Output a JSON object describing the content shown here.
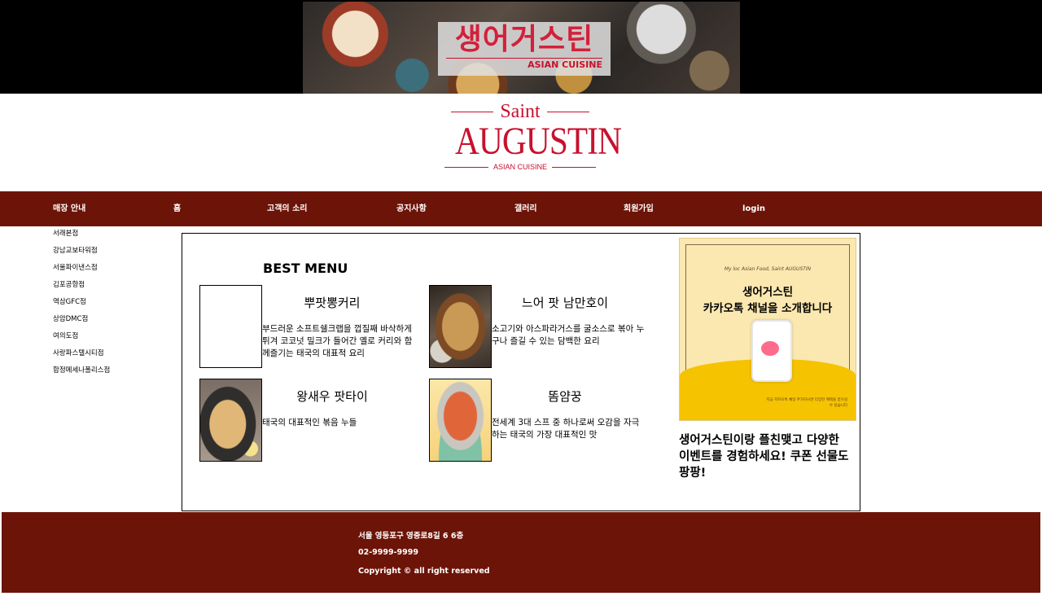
{
  "banner": {
    "sign_korean": "생어거스틴",
    "sign_english": "ASIAN CUISINE"
  },
  "logo": {
    "saint": "Saint",
    "main": "AUGUSTIN",
    "sub": "ASIAN CUISINE"
  },
  "nav": {
    "items": [
      {
        "label": "매장 안내"
      },
      {
        "label": "홈"
      },
      {
        "label": "고객의 소리"
      },
      {
        "label": "공지사항"
      },
      {
        "label": "갤러리"
      },
      {
        "label": "회원가입"
      },
      {
        "label": "login"
      }
    ]
  },
  "sidebar": {
    "items": [
      {
        "label": "서래본점"
      },
      {
        "label": "강남교보타워점"
      },
      {
        "label": "서울파이낸스점"
      },
      {
        "label": "김포공항점"
      },
      {
        "label": "역삼GFC점"
      },
      {
        "label": "상암DMC점"
      },
      {
        "label": "여의도점"
      },
      {
        "label": "사랑파스텔시티점"
      },
      {
        "label": "합정메세나폴리스점"
      }
    ]
  },
  "main": {
    "best_title": "BEST MENU",
    "menus": [
      {
        "name": "뿌팟뽕커리",
        "desc": "부드러운 소프트쉘크랩을 껍질째 바삭하게튀겨 코코넛 밀크가 들어간 옐로 커리와 함께즐기는 태국의 대표적 요리"
      },
      {
        "name": "느어 팟 남만호이",
        "desc": "소고기와 아스파라거스를 굴소스로 볶아 누구나 즐길 수 있는 담백한 요리"
      },
      {
        "name": "왕새우 팟타이",
        "desc": "태국의 대표적인 볶음 누들"
      },
      {
        "name": "똠얌꿍",
        "desc": "전세계 3대 스프 중 하나로써 오감을 자극하는 태국의 가장 대표적인 맛"
      }
    ],
    "promo": {
      "small": "My loc Asian Food, Saint AUGUSTIN",
      "line1": "생어거스틴",
      "line2": "카카오톡 채널을 소개합니다",
      "note": "지금 카카오톡 채널 추가하시면 다양한 혜택을 받으실 수 있습니다",
      "text": "생어거스틴이랑 플친맺고 다양한 이벤트를 경험하세요! 쿠폰 선물도 팡팡!"
    }
  },
  "footer": {
    "address": "서울 영등포구 영중로8길 6 6층",
    "phone": "02-9999-9999",
    "copyright": "Copyright © all right reserved"
  }
}
